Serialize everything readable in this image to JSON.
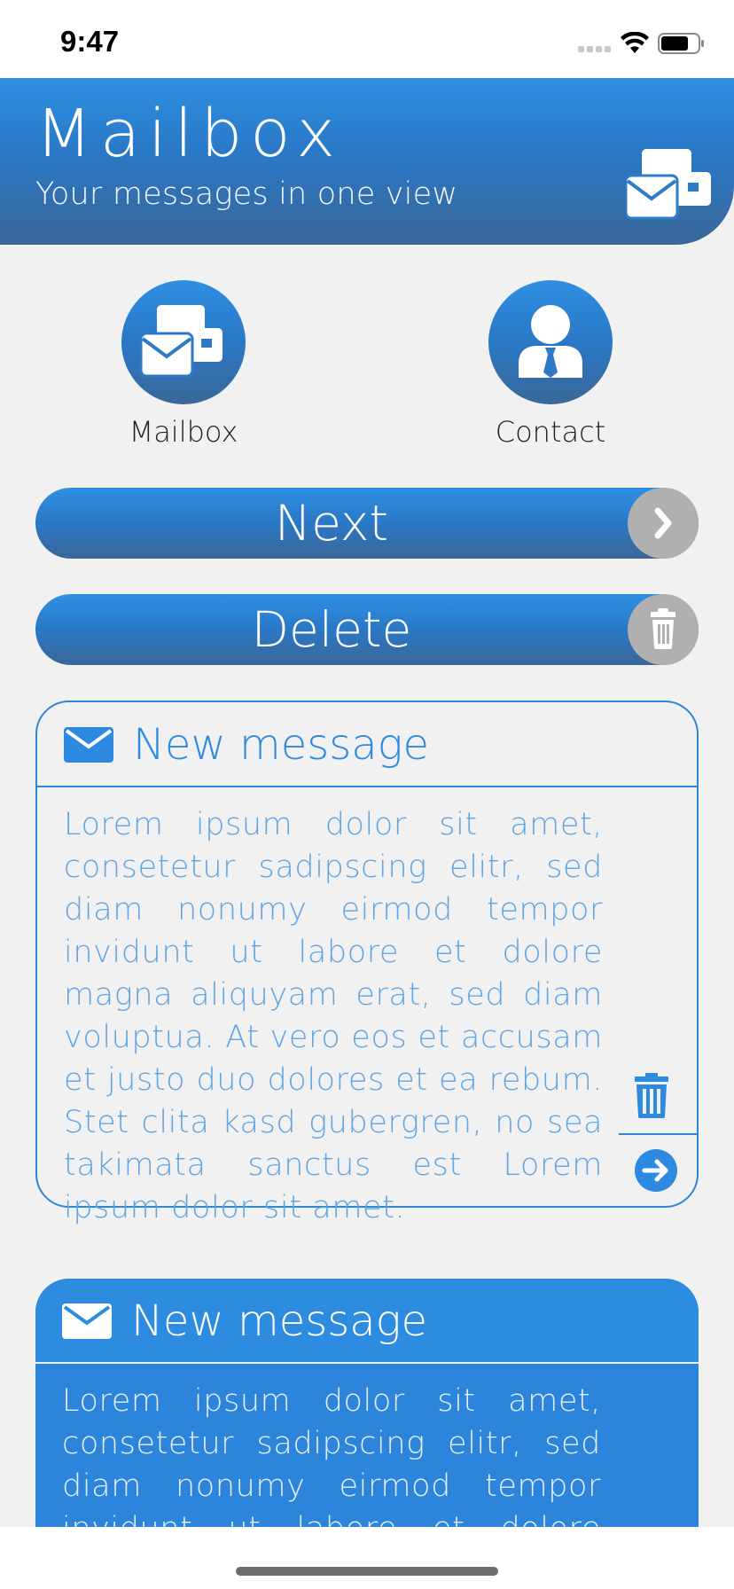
{
  "status_bar": {
    "time": "9:47"
  },
  "header": {
    "title": "Mailbox",
    "subtitle": "Your messages in one view",
    "icon": "mailbox-icon"
  },
  "shortcuts": [
    {
      "label": "Mailbox",
      "icon": "mailbox-icon"
    },
    {
      "label": "Contact",
      "icon": "contact-person-icon"
    }
  ],
  "buttons": {
    "next": {
      "label": "Next",
      "icon": "chevron-right-icon"
    },
    "delete": {
      "label": "Delete",
      "icon": "trash-icon"
    }
  },
  "messages": [
    {
      "title": "New message",
      "body": "Lorem ipsum dolor sit amet, consetetur sadipscing elitr, sed diam nonumy eirmod tempor invidunt ut labore et dolore magna aliquyam erat, sed diam voluptua. At vero eos et accusam et justo duo dolores et ea rebum. Stet clita kasd gubergren, no sea takimata sanctus est Lorem ipsum dolor sit amet.",
      "style": "outlined"
    },
    {
      "title": "New message",
      "body": "Lorem ipsum dolor sit amet, consetetur sadipscing elitr, sed diam nonumy eirmod tempor invidunt ut labore et dolore magna aliquyam erat,",
      "style": "filled"
    }
  ],
  "colors": {
    "accent": "#2d86d8",
    "accent_dark": "#3a6798",
    "background": "#f1f1f1",
    "knob": "#b0b0b0"
  }
}
